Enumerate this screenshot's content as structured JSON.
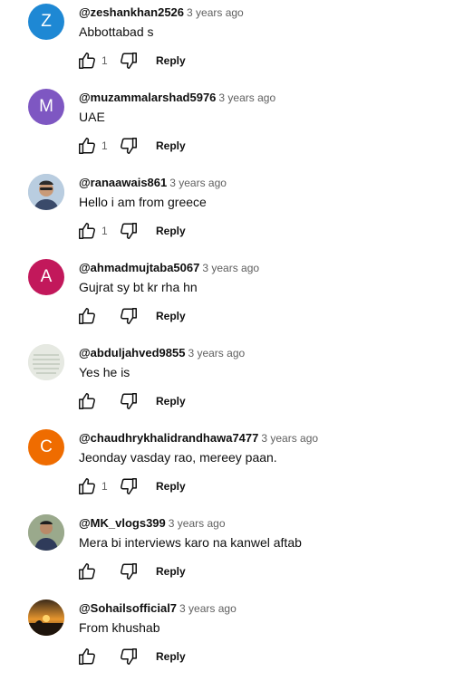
{
  "comments": [
    {
      "author": "@zeshankhan2526",
      "time": "3 years ago",
      "text": "Abbottabad s",
      "likes": "1",
      "avatar_letter": "Z",
      "avatar_color": "#1e88d4",
      "reply_label": "Reply"
    },
    {
      "author": "@muzammalarshad5976",
      "time": "3 years ago",
      "text": "UAE",
      "likes": "1",
      "avatar_letter": "M",
      "avatar_color": "#7e57c2",
      "reply_label": "Reply"
    },
    {
      "author": "@ranaawais861",
      "time": "3 years ago",
      "text": "Hello i am from greece",
      "likes": "1",
      "avatar_letter": "",
      "avatar_color": "#9bb3c8",
      "reply_label": "Reply"
    },
    {
      "author": "@ahmadmujtaba5067",
      "time": "3 years ago",
      "text": "Gujrat sy bt kr rha hn",
      "likes": "",
      "avatar_letter": "A",
      "avatar_color": "#c2185b",
      "reply_label": "Reply"
    },
    {
      "author": "@abduljahved9855",
      "time": "3 years ago",
      "text": "Yes he is",
      "likes": "",
      "avatar_letter": "",
      "avatar_color": "#d9ddd4",
      "reply_label": "Reply"
    },
    {
      "author": "@chaudhrykhalidrandhawa7477",
      "time": "3 years ago",
      "text": "Jeonday vasday rao, mereey paan.",
      "likes": "1",
      "avatar_letter": "C",
      "avatar_color": "#ef6c00",
      "reply_label": "Reply"
    },
    {
      "author": "@MK_vlogs399",
      "time": "3 years ago",
      "text": "Mera bi interviews karo na kanwel aftab",
      "likes": "",
      "avatar_letter": "",
      "avatar_color": "#8a9a7c",
      "reply_label": "Reply"
    },
    {
      "author": "@Sohailsofficial7",
      "time": "3 years ago",
      "text": "From khushab",
      "likes": "",
      "avatar_letter": "",
      "avatar_color": "#e08a2a",
      "reply_label": "Reply"
    }
  ]
}
